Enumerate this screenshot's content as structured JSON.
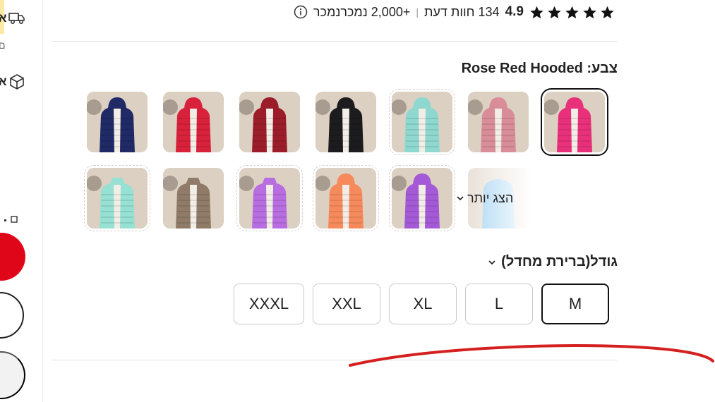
{
  "side_panel": {
    "row1_text": "א",
    "row1_sub": "ם",
    "row2_text": "א",
    "icons": [
      "truck-icon",
      "box-icon"
    ]
  },
  "rating": {
    "score": "4.9",
    "reviews": "134 חוות דעת",
    "separator": "|",
    "sold": "+2,000 נמכרנמכר",
    "stars_filled": 5
  },
  "color": {
    "label": "צבע: Rose Red Hooded",
    "selected": "Rose Red Hooded",
    "swatches_row1": [
      {
        "name": "rose-red-hooded",
        "color": "#e8317a",
        "hood": true,
        "selected": true
      },
      {
        "name": "pink-hooded",
        "color": "#d88d98",
        "hood": true
      },
      {
        "name": "mint-hooded",
        "color": "#8fd8cf",
        "hood": true,
        "dashed": true
      },
      {
        "name": "black-hooded",
        "color": "#1c1c1e",
        "hood": true
      },
      {
        "name": "wine-hooded",
        "color": "#9b1d2a",
        "hood": true
      },
      {
        "name": "red-hooded",
        "color": "#d8213a",
        "hood": true
      },
      {
        "name": "navy-hooded",
        "color": "#1f2a66",
        "hood": true
      }
    ],
    "swatches_row2": [
      {
        "name": "purple-hooded",
        "color": "#a45ad6",
        "hood": true,
        "dashed": true
      },
      {
        "name": "orange-hooded",
        "color": "#f78a5c",
        "hood": true,
        "dashed": true
      },
      {
        "name": "purple-collar",
        "color": "#b86de0",
        "hood": false,
        "dashed": true
      },
      {
        "name": "khaki-collar",
        "color": "#8f7b68",
        "hood": false
      },
      {
        "name": "mint-collar",
        "color": "#96e0d4",
        "hood": false,
        "dashed": true
      }
    ],
    "more_swatch_color": "#9fd0f2",
    "show_more": "הצג יותר"
  },
  "size": {
    "label": "גודל(ברירת מחדל)",
    "options": [
      "M",
      "L",
      "XL",
      "XXL",
      "XXXL"
    ],
    "selected": "M"
  },
  "colors": {
    "accent_red": "#e0061a",
    "annotation_red": "#d42020",
    "selected_border": "#111111"
  }
}
